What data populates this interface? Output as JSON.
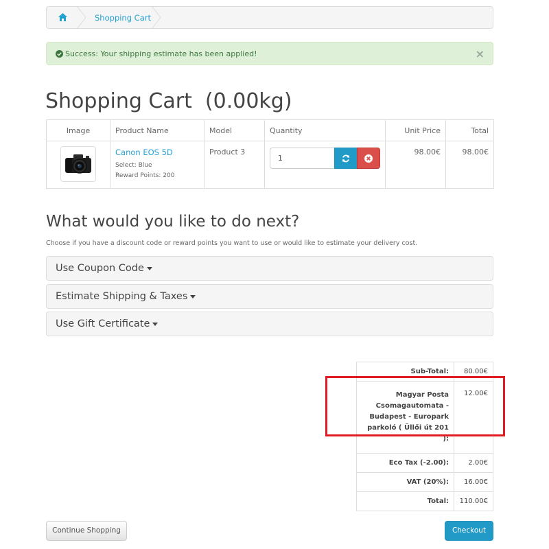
{
  "breadcrumb": {
    "home_icon": "home-icon",
    "current": "Shopping Cart"
  },
  "alert": {
    "text": "Success: Your shipping estimate has been applied!",
    "close": "×",
    "icon": "check-circle-icon",
    "color": "#3c763d"
  },
  "page_title": "Shopping Cart  (0.00kg)",
  "cart_table": {
    "headers": [
      "Image",
      "Product Name",
      "Model",
      "Quantity",
      "Unit Price",
      "Total"
    ],
    "rows": [
      {
        "product_name": "Canon EOS 5D",
        "option": "Select: Blue",
        "reward": "Reward Points: 200",
        "model": "Product 3",
        "quantity": "1",
        "unit_price": "98.00€",
        "total": "98.00€"
      }
    ]
  },
  "next_section": {
    "title": "What would you like to do next?",
    "description": "Choose if you have a discount code or reward points you want to use or would like to estimate your delivery cost.",
    "panels": [
      "Use Coupon Code",
      "Estimate Shipping & Taxes",
      "Use Gift Certificate"
    ]
  },
  "totals": [
    {
      "label": "Sub-Total:",
      "value": "80.00€"
    },
    {
      "label": "Magyar Posta Csomagautomata - Budapest - Europark parkoló ( Üllői út 201 ):",
      "value": "12.00€"
    },
    {
      "label": "Eco Tax (-2.00):",
      "value": "2.00€"
    },
    {
      "label": "VAT (20%):",
      "value": "16.00€"
    },
    {
      "label": "Total:",
      "value": "110.00€"
    }
  ],
  "buttons": {
    "continue": "Continue Shopping",
    "checkout": "Checkout"
  },
  "colors": {
    "accent": "#229ac8",
    "danger": "#da4f49",
    "highlight": "#e01b24"
  }
}
